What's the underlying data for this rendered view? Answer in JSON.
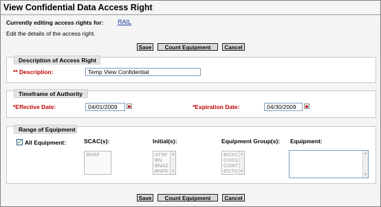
{
  "page": {
    "title": "View Confidential Data Access Right",
    "editing_label": "Currently editing access rights for:",
    "editing_value": "RAIL",
    "subtitle": "Edit the details of the access right."
  },
  "buttons": {
    "save": "Save",
    "count": "Count  Equipment",
    "cancel": "Cancel"
  },
  "description": {
    "legend": "Description of Access Right",
    "label": "** Description:",
    "value": "Temp View Confidential"
  },
  "timeframe": {
    "legend": "Timeframe of Authority",
    "effective_label": "*Effective Date:",
    "effective_value": "04/01/2009",
    "expiration_label": "*Expiration Date:",
    "expiration_value": "04/30/2009"
  },
  "equipment": {
    "legend": "Range of Equipment",
    "all_label": "All Equipment:",
    "all_checked": true,
    "scac_label": "SCAC(s):",
    "scac_items": [
      "BNSF"
    ],
    "initial_label": "Initial(s):",
    "initial_items": [
      "ATSF",
      "BN",
      "BNAZ",
      "BNFE"
    ],
    "group_label": "Equipment Group(s):",
    "group_items": [
      "BOXC",
      "CHSS",
      "CONT",
      "EOTD"
    ],
    "equip_label": "Equipment:",
    "equip_value": ""
  }
}
